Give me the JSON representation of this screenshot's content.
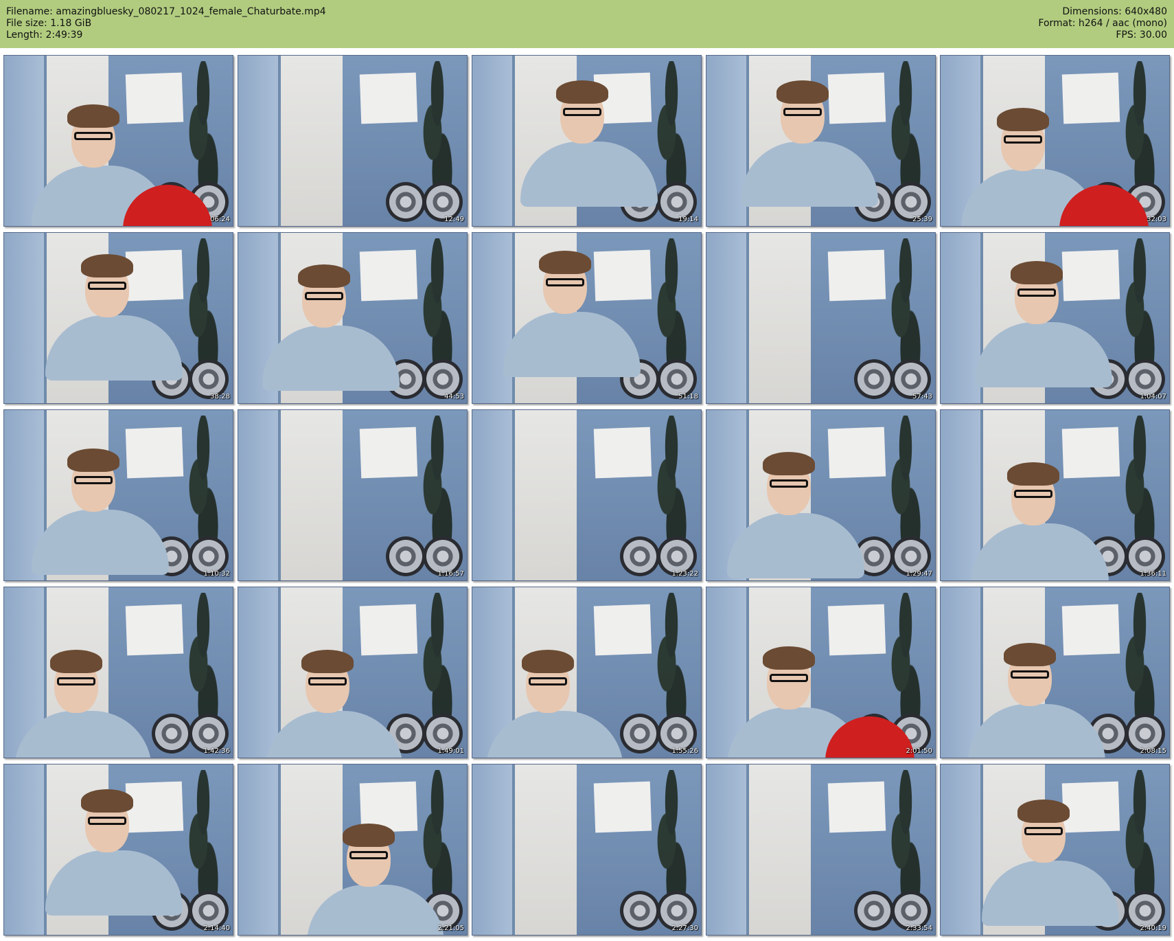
{
  "header": {
    "left": [
      {
        "label": "Filename:",
        "value": "amazingbluesky_080217_1024_female_Chaturbate.mp4"
      },
      {
        "label": "File size:",
        "value": "1.18 GiB"
      },
      {
        "label": "Length:",
        "value": "2:49:39"
      }
    ],
    "right": [
      {
        "label": "Dimensions:",
        "value": "640x480"
      },
      {
        "label": "Format:",
        "value": "h264 / aac (mono)"
      },
      {
        "label": "FPS:",
        "value": "30.00"
      }
    ]
  },
  "thumbnails": [
    {
      "time": "06:24"
    },
    {
      "time": "12:49"
    },
    {
      "time": "19:14"
    },
    {
      "time": "25:39"
    },
    {
      "time": "32:03"
    },
    {
      "time": "38:28"
    },
    {
      "time": "44:53"
    },
    {
      "time": "51:18"
    },
    {
      "time": "57:43"
    },
    {
      "time": "1:04:07"
    },
    {
      "time": "1:10:32"
    },
    {
      "time": "1:16:57"
    },
    {
      "time": "1:23:22"
    },
    {
      "time": "1:29:47"
    },
    {
      "time": "1:36:11"
    },
    {
      "time": "1:42:36"
    },
    {
      "time": "1:49:01"
    },
    {
      "time": "1:55:26"
    },
    {
      "time": "2:01:50"
    },
    {
      "time": "2:08:15"
    },
    {
      "time": "2:14:40"
    },
    {
      "time": "2:21:05"
    },
    {
      "time": "2:27:30"
    },
    {
      "time": "2:33:54"
    },
    {
      "time": "2:40:19"
    }
  ]
}
